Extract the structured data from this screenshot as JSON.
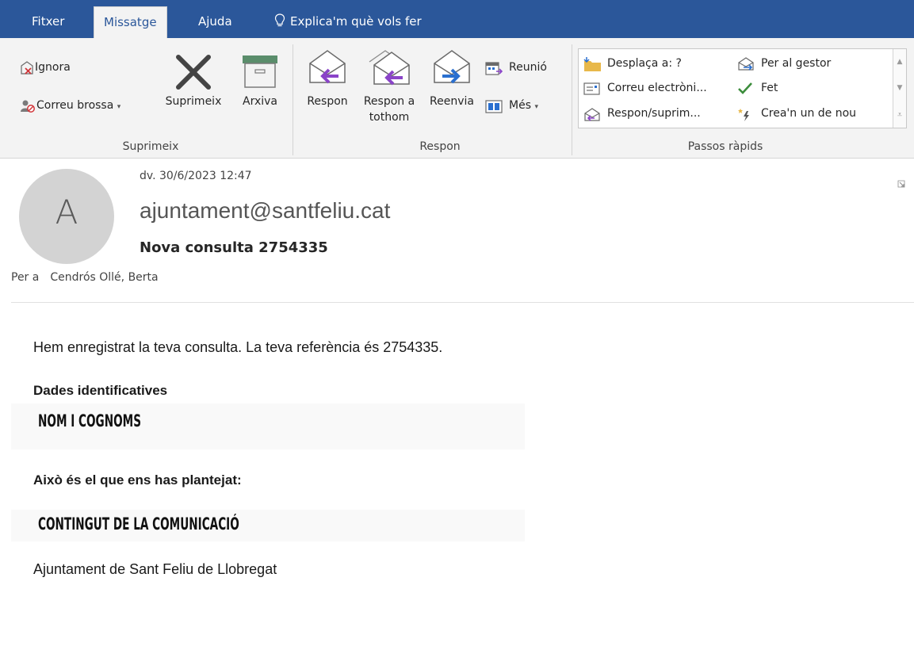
{
  "menu": {
    "tabs": [
      "Fitxer",
      "Missatge",
      "Ajuda"
    ],
    "tell_me": "Explica'm què vols fer",
    "active_tab": "Missatge"
  },
  "ribbon": {
    "delete_group": {
      "label": "Suprimeix",
      "ignore": "Ignora",
      "junk": "Correu brossa",
      "delete": "Suprimeix",
      "archive": "Arxiva"
    },
    "respond_group": {
      "label": "Respon",
      "reply": "Respon",
      "reply_all_line1": "Respon a",
      "reply_all_line2": "tothom",
      "forward": "Reenvia",
      "meeting": "Reunió",
      "more": "Més"
    },
    "quick_steps": {
      "label": "Passos ràpids",
      "items": [
        "Desplaça a: ?",
        "Correu electròni...",
        "Respon/suprim...",
        "Per al gestor",
        "Fet",
        "Crea'n un de nou"
      ]
    }
  },
  "email": {
    "avatar_letter": "A",
    "date": "dv. 30/6/2023 12:47",
    "sender": "ajuntament@santfeliu.cat",
    "subject": "Nova consulta 2754335",
    "to_label": "Per a",
    "to_name": "Cendrós Ollé, Berta",
    "body": {
      "intro": "Hem enregistrat la teva consulta. La teva referència és 2754335.",
      "identity_heading": "Dades identificatives",
      "identity_value": "NOM I COGNOMS",
      "question_heading": "Això és el que ens has plantejat:",
      "question_value": "CONTINGUT DE LA COMUNICACIÓ",
      "signature": "Ajuntament de Sant Feliu de Llobregat"
    }
  },
  "colors": {
    "accent": "#2b579a",
    "reply_purple": "#8a44c8",
    "forward_blue": "#2a6fcf",
    "done_green": "#3c8d3c"
  }
}
